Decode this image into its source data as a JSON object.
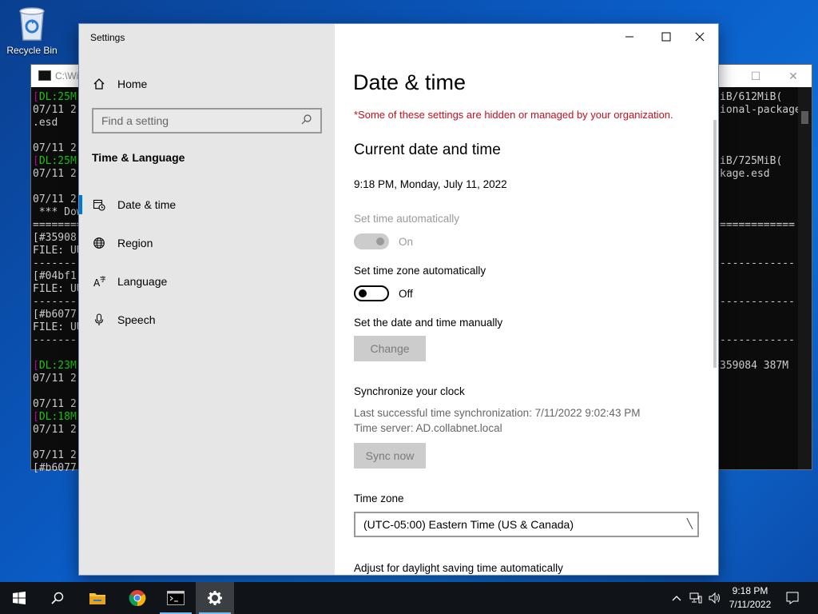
{
  "desktop": {
    "recycle_bin_label": "Recycle Bin"
  },
  "console": {
    "title": "C:\\Wi",
    "lines_left": [
      {
        "pre": "[",
        "hl": "DL:25M",
        "hl_class": "g",
        "post": ""
      },
      {
        "pre": "07/11 2",
        "hl": "",
        "hl_class": "",
        "post": ""
      },
      {
        "pre": ".esd",
        "hl": "",
        "hl_class": "",
        "post": ""
      },
      {
        "pre": "",
        "hl": "",
        "hl_class": "",
        "post": ""
      },
      {
        "pre": "07/11 2",
        "hl": "",
        "hl_class": "",
        "post": ""
      },
      {
        "pre": "[",
        "hl": "DL:25M",
        "hl_class": "g",
        "post": ""
      },
      {
        "pre": "07/11 2",
        "hl": "",
        "hl_class": "",
        "post": ""
      },
      {
        "pre": "",
        "hl": "",
        "hl_class": "",
        "post": ""
      },
      {
        "pre": "07/11 2",
        "hl": "",
        "hl_class": "",
        "post": ""
      },
      {
        "pre": " *** Dow",
        "hl": "",
        "hl_class": "",
        "post": ""
      },
      {
        "pre": "========",
        "hl": "",
        "hl_class": "",
        "post": ""
      },
      {
        "pre": "[#35908",
        "hl": "",
        "hl_class": "",
        "post": ""
      },
      {
        "pre": "FILE: UU",
        "hl": "",
        "hl_class": "",
        "post": ""
      },
      {
        "pre": "--------",
        "hl": "",
        "hl_class": "",
        "post": ""
      },
      {
        "pre": "[#04bf1",
        "hl": "",
        "hl_class": "",
        "post": ""
      },
      {
        "pre": "FILE: UU",
        "hl": "",
        "hl_class": "",
        "post": ""
      },
      {
        "pre": "--------",
        "hl": "",
        "hl_class": "",
        "post": ""
      },
      {
        "pre": "[#b6077",
        "hl": "",
        "hl_class": "",
        "post": ""
      },
      {
        "pre": "FILE: UU",
        "hl": "",
        "hl_class": "",
        "post": ""
      },
      {
        "pre": "--------",
        "hl": "",
        "hl_class": "",
        "post": ""
      },
      {
        "pre": "",
        "hl": "",
        "hl_class": "",
        "post": ""
      },
      {
        "pre": "[",
        "hl": "DL:23M",
        "hl_class": "g",
        "post": ""
      },
      {
        "pre": "07/11 2",
        "hl": "",
        "hl_class": "",
        "post": ""
      },
      {
        "pre": "",
        "hl": "",
        "hl_class": "",
        "post": ""
      },
      {
        "pre": "07/11 2",
        "hl": "",
        "hl_class": "",
        "post": ""
      },
      {
        "pre": "[",
        "hl": "DL:18M",
        "hl_class": "g",
        "post": ""
      },
      {
        "pre": "07/11 2",
        "hl": "",
        "hl_class": "",
        "post": ""
      },
      {
        "pre": "",
        "hl": "",
        "hl_class": "",
        "post": ""
      },
      {
        "pre": "07/11 2",
        "hl": "",
        "hl_class": "",
        "post": ""
      },
      {
        "pre": "[#b6077",
        "hl": "",
        "hl_class": "",
        "post": ""
      }
    ],
    "lines_right": [
      {
        "row": 0,
        "text": "iB/612MiB("
      },
      {
        "row": 1,
        "text": "ional-package"
      },
      {
        "row": 5,
        "text": "iB/725MiB("
      },
      {
        "row": 6,
        "text": "kage.esd"
      },
      {
        "row": 10,
        "text": "============"
      },
      {
        "row": 13,
        "text": "------------"
      },
      {
        "row": 16,
        "text": "------------"
      },
      {
        "row": 19,
        "text": "------------"
      },
      {
        "row": 21,
        "text": "359084 387M"
      }
    ]
  },
  "settings": {
    "app_title": "Settings",
    "home_label": "Home",
    "search_placeholder": "Find a setting",
    "section_title": "Time & Language",
    "nav_items": [
      {
        "label": "Date & time",
        "icon": "calendar-clock-icon"
      },
      {
        "label": "Region",
        "icon": "globe-icon"
      },
      {
        "label": "Language",
        "icon": "language-icon"
      },
      {
        "label": "Speech",
        "icon": "microphone-icon"
      }
    ],
    "page_title": "Date & time",
    "managed_warning": "*Some of these settings are hidden or managed by your organization.",
    "current_heading": "Current date and time",
    "current_datetime": "9:18 PM, Monday, July 11, 2022",
    "set_time_auto": {
      "label": "Set time automatically",
      "state": "On"
    },
    "set_tz_auto": {
      "label": "Set time zone automatically",
      "state": "Off"
    },
    "manual_label": "Set the date and time manually",
    "change_button": "Change",
    "sync_heading": "Synchronize your clock",
    "last_sync": "Last successful time synchronization: 7/11/2022 9:02:43 PM",
    "time_server": "Time server: AD.collabnet.local",
    "sync_button": "Sync now",
    "timezone_label": "Time zone",
    "timezone_value": "(UTC-05:00) Eastern Time (US & Canada)",
    "dst_label": "Adjust for daylight saving time automatically"
  },
  "taskbar": {
    "time": "9:18 PM",
    "date": "7/11/2022"
  },
  "colors": {
    "accent": "#0078d7",
    "warning": "#c50f1f",
    "console_green": "#16c60c",
    "console_magenta": "#b4009e"
  }
}
